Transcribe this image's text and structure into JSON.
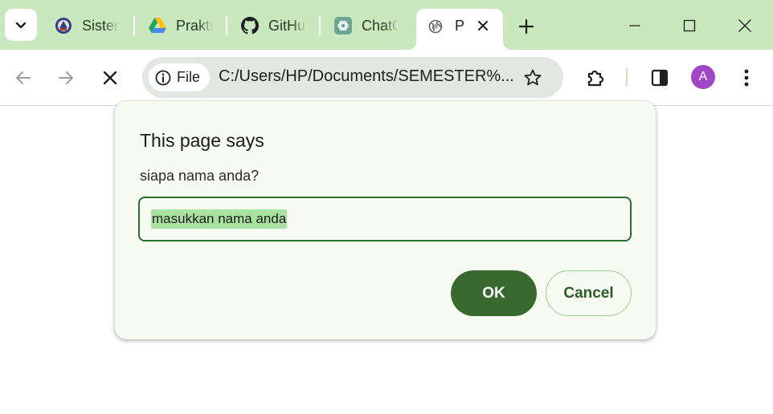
{
  "browser": {
    "tabs": [
      {
        "title": "Sister",
        "icon": "university-seal-icon"
      },
      {
        "title": "Prakti",
        "icon": "google-drive-icon"
      },
      {
        "title": "GitHu",
        "icon": "github-icon"
      },
      {
        "title": "ChatG",
        "icon": "chatgpt-icon"
      }
    ],
    "active_tab": {
      "title": "P",
      "icon": "globe-icon"
    },
    "omnibox": {
      "chip_label": "File",
      "url": "C:/Users/HP/Documents/SEMESTER%..."
    },
    "profile_initial": "A"
  },
  "dialog": {
    "title": "This page says",
    "message": "siapa nama anda?",
    "input_value": "masukkan nama anda",
    "ok_label": "OK",
    "cancel_label": "Cancel"
  },
  "colors": {
    "tabstrip": "#c9e8be",
    "accent": "#386a2f",
    "input_border": "#2f6b35",
    "selection": "#a9e1a1",
    "avatar": "#a046c6"
  }
}
